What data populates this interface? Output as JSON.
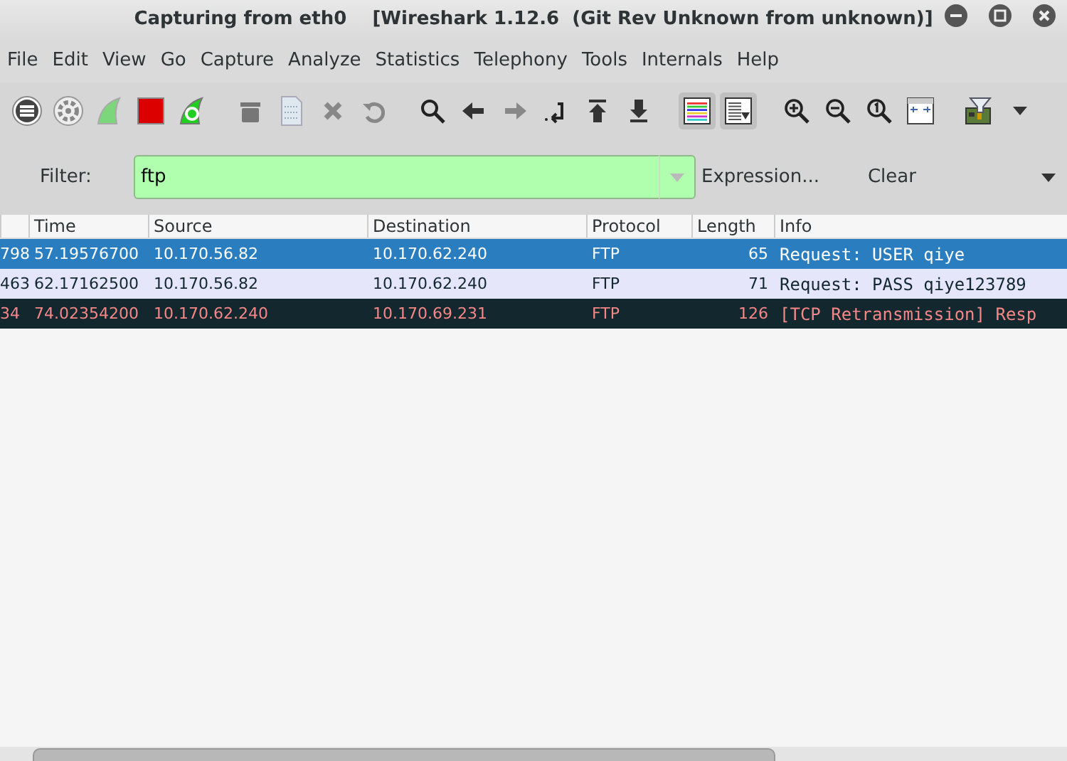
{
  "window": {
    "title": "Capturing from eth0    [Wireshark 1.12.6  (Git Rev Unknown from unknown)]"
  },
  "menu": [
    "File",
    "Edit",
    "View",
    "Go",
    "Capture",
    "Analyze",
    "Statistics",
    "Telephony",
    "Tools",
    "Internals",
    "Help"
  ],
  "toolbar": {
    "colorize_on": true,
    "autoscroll_on": true
  },
  "filter": {
    "label": "Filter:",
    "value": "ftp",
    "valid": true,
    "buttons": [
      "Expression...",
      "Clear"
    ]
  },
  "table": {
    "columns": [
      "",
      "Time",
      "Source",
      "Destination",
      "Protocol",
      "Length",
      "Info"
    ],
    "rows": [
      {
        "selected": true,
        "cells": [
          "798",
          "57.19576700",
          "10.170.56.82",
          "10.170.62.240",
          "FTP",
          "65",
          "Request: USER qiye"
        ]
      },
      {
        "selected": false,
        "kind": "ftp",
        "cells": [
          "463",
          "62.17162500",
          "10.170.56.82",
          "10.170.62.240",
          "FTP",
          "71",
          "Request: PASS qiye123789"
        ]
      },
      {
        "selected": false,
        "kind": "bad-tcp",
        "cells": [
          "34",
          "74.02354200",
          "10.170.62.240",
          "10.170.69.231",
          "FTP",
          "126",
          "[TCP Retransmission] Resp"
        ]
      }
    ]
  }
}
